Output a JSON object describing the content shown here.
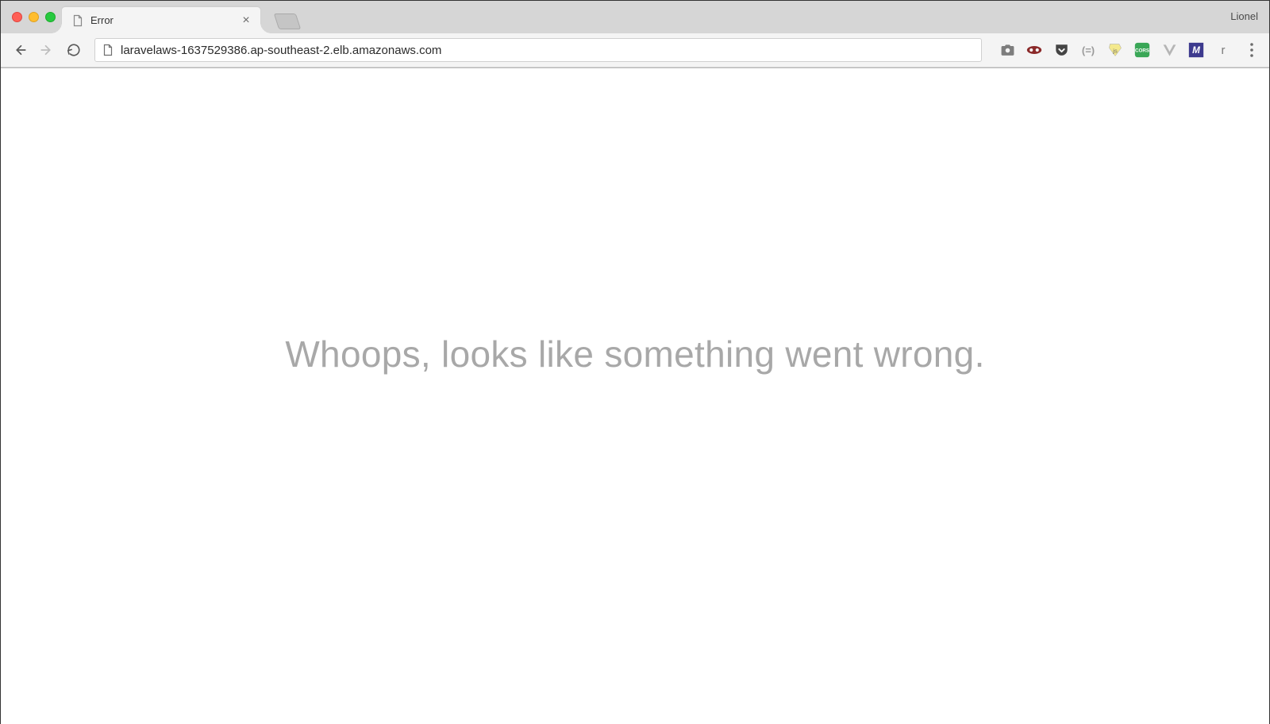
{
  "browser": {
    "profile_name": "Lionel",
    "tab": {
      "title": "Error"
    },
    "url": "laravelaws-1637529386.ap-southeast-2.elb.amazonaws.com",
    "extensions": {
      "r_label": "r"
    }
  },
  "page": {
    "error_message": "Whoops, looks like something went wrong."
  }
}
